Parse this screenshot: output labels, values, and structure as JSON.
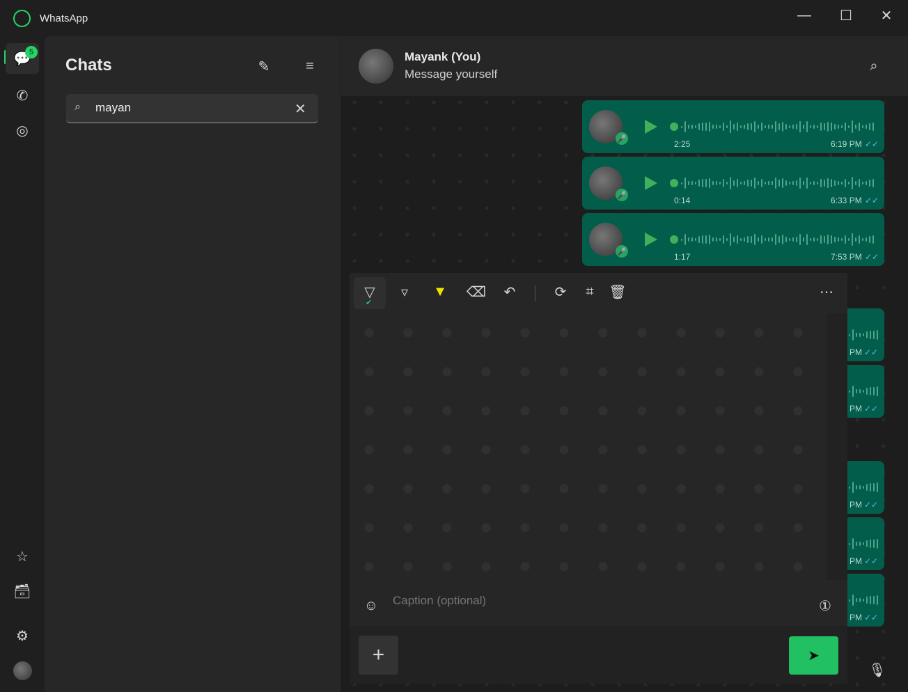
{
  "app": {
    "title": "WhatsApp",
    "brand_color": "#25d366"
  },
  "rail": {
    "chats_badge": "5",
    "icons": [
      "chats-icon",
      "calls-icon",
      "status-icon",
      "starred-icon",
      "archived-icon",
      "settings-icon",
      "profile-avatar"
    ]
  },
  "chats": {
    "title": "Chats",
    "search_value": "mayan",
    "search_placeholder": "Search"
  },
  "header": {
    "name": "Mayank (You)",
    "subtitle": "Message yourself"
  },
  "messages": [
    {
      "duration": "2:25",
      "time": "6:19 PM"
    },
    {
      "duration": "0:14",
      "time": "6:33 PM"
    },
    {
      "duration": "1:17",
      "time": "7:53 PM"
    }
  ],
  "partial_messages": [
    "PM",
    "PM",
    "PM",
    "PM",
    "PM"
  ],
  "editor": {
    "tools": [
      "pen",
      "pencil",
      "highlighter",
      "eraser",
      "undo",
      "rotate",
      "crop",
      "delete",
      "more"
    ],
    "selected_tool": "pen",
    "caption_placeholder": "Caption (optional)",
    "accent": "#21c063"
  }
}
